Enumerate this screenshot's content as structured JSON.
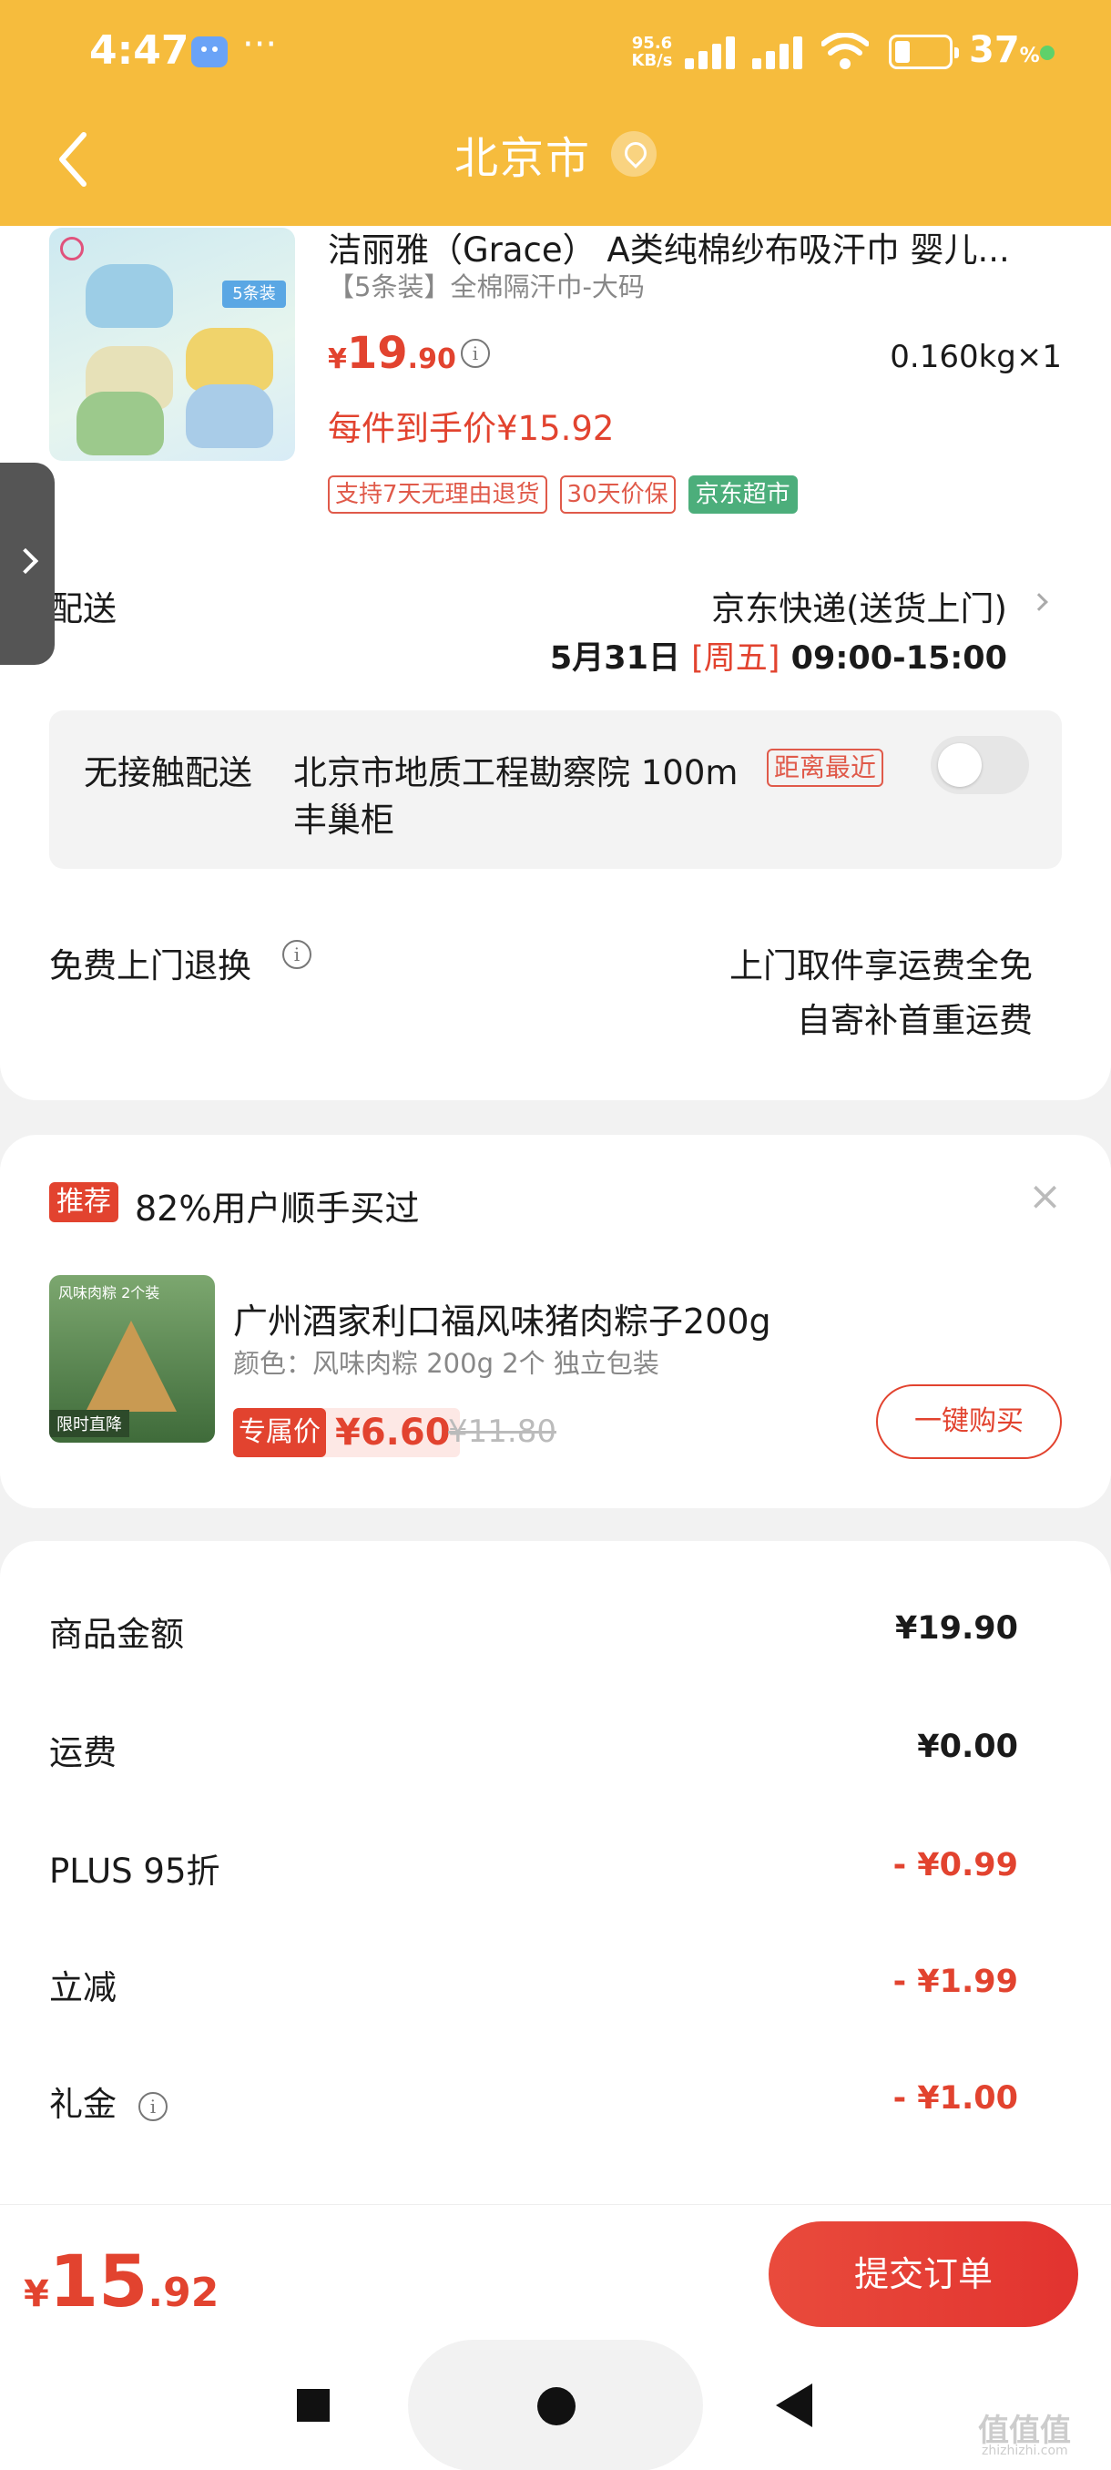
{
  "status_bar": {
    "time": "4:47",
    "dots": "···",
    "speed_value": "95.6",
    "speed_unit": "KB/s",
    "battery_percent": "37",
    "battery_sign": "%"
  },
  "header": {
    "title": "北京市",
    "back_icon": "chevron-left-icon",
    "location_icon": "location-pin-icon"
  },
  "product": {
    "title": "洁丽雅（Grace） A类纯棉纱布吸汗巾 婴儿...",
    "spec": "【5条装】全棉隔汗巾-大码",
    "price_currency": "¥",
    "price_integer": "19",
    "price_decimal": ".90",
    "weight": "0.160kg×1",
    "hand_price": "每件到手价¥15.92",
    "thumb_badge": "5条装",
    "tags": [
      "支持7天无理由退货",
      "30天价保",
      "京东超市"
    ]
  },
  "delivery": {
    "label": "配送",
    "method": "京东快递(送货上门)",
    "date": "5月31日",
    "weekday": "[周五]",
    "time": "09:00-15:00"
  },
  "no_contact": {
    "label": "无接触配送",
    "location_line1": "北京市地质工程勘察院  100m",
    "location_line2": "丰巢柜",
    "nearest_tag": "距离最近",
    "enabled": false
  },
  "returns": {
    "label": "免费上门退换",
    "line1": "上门取件享运费全免",
    "line2": "自寄补首重运费"
  },
  "recommend": {
    "badge": "推荐",
    "text": "82%用户顺手买过",
    "close": "×",
    "img_label": "风味肉粽 2个装",
    "img_flash": "限时直降",
    "title": "广州酒家利口福风味猪肉粽子200g",
    "spec": "颜色：风味肉粽 200g 2个 独立包装",
    "price_label": "专属价",
    "price": "¥6.60",
    "old_price": "¥11.80",
    "buy_button": "一键购买"
  },
  "fees": [
    {
      "label": "商品金额",
      "value": "¥19.90",
      "red": false,
      "info": false
    },
    {
      "label": "运费",
      "value": "¥0.00",
      "red": false,
      "info": false
    },
    {
      "label": "PLUS 95折",
      "value": "- ¥0.99",
      "red": true,
      "info": false
    },
    {
      "label": "立减",
      "value": "- ¥1.99",
      "red": true,
      "info": false
    },
    {
      "label": "礼金",
      "value": "- ¥1.00",
      "red": true,
      "info": true
    }
  ],
  "footer": {
    "total_currency": "¥",
    "total_integer": "15",
    "total_decimal": ".92",
    "submit_label": "提交订单",
    "watermark": "值值值",
    "watermark_sub": "zhizhizhi.com"
  },
  "colors": {
    "header_bg": "#f6bc3d",
    "accent_red": "#e2432f",
    "green_tag": "#4cae7b"
  }
}
